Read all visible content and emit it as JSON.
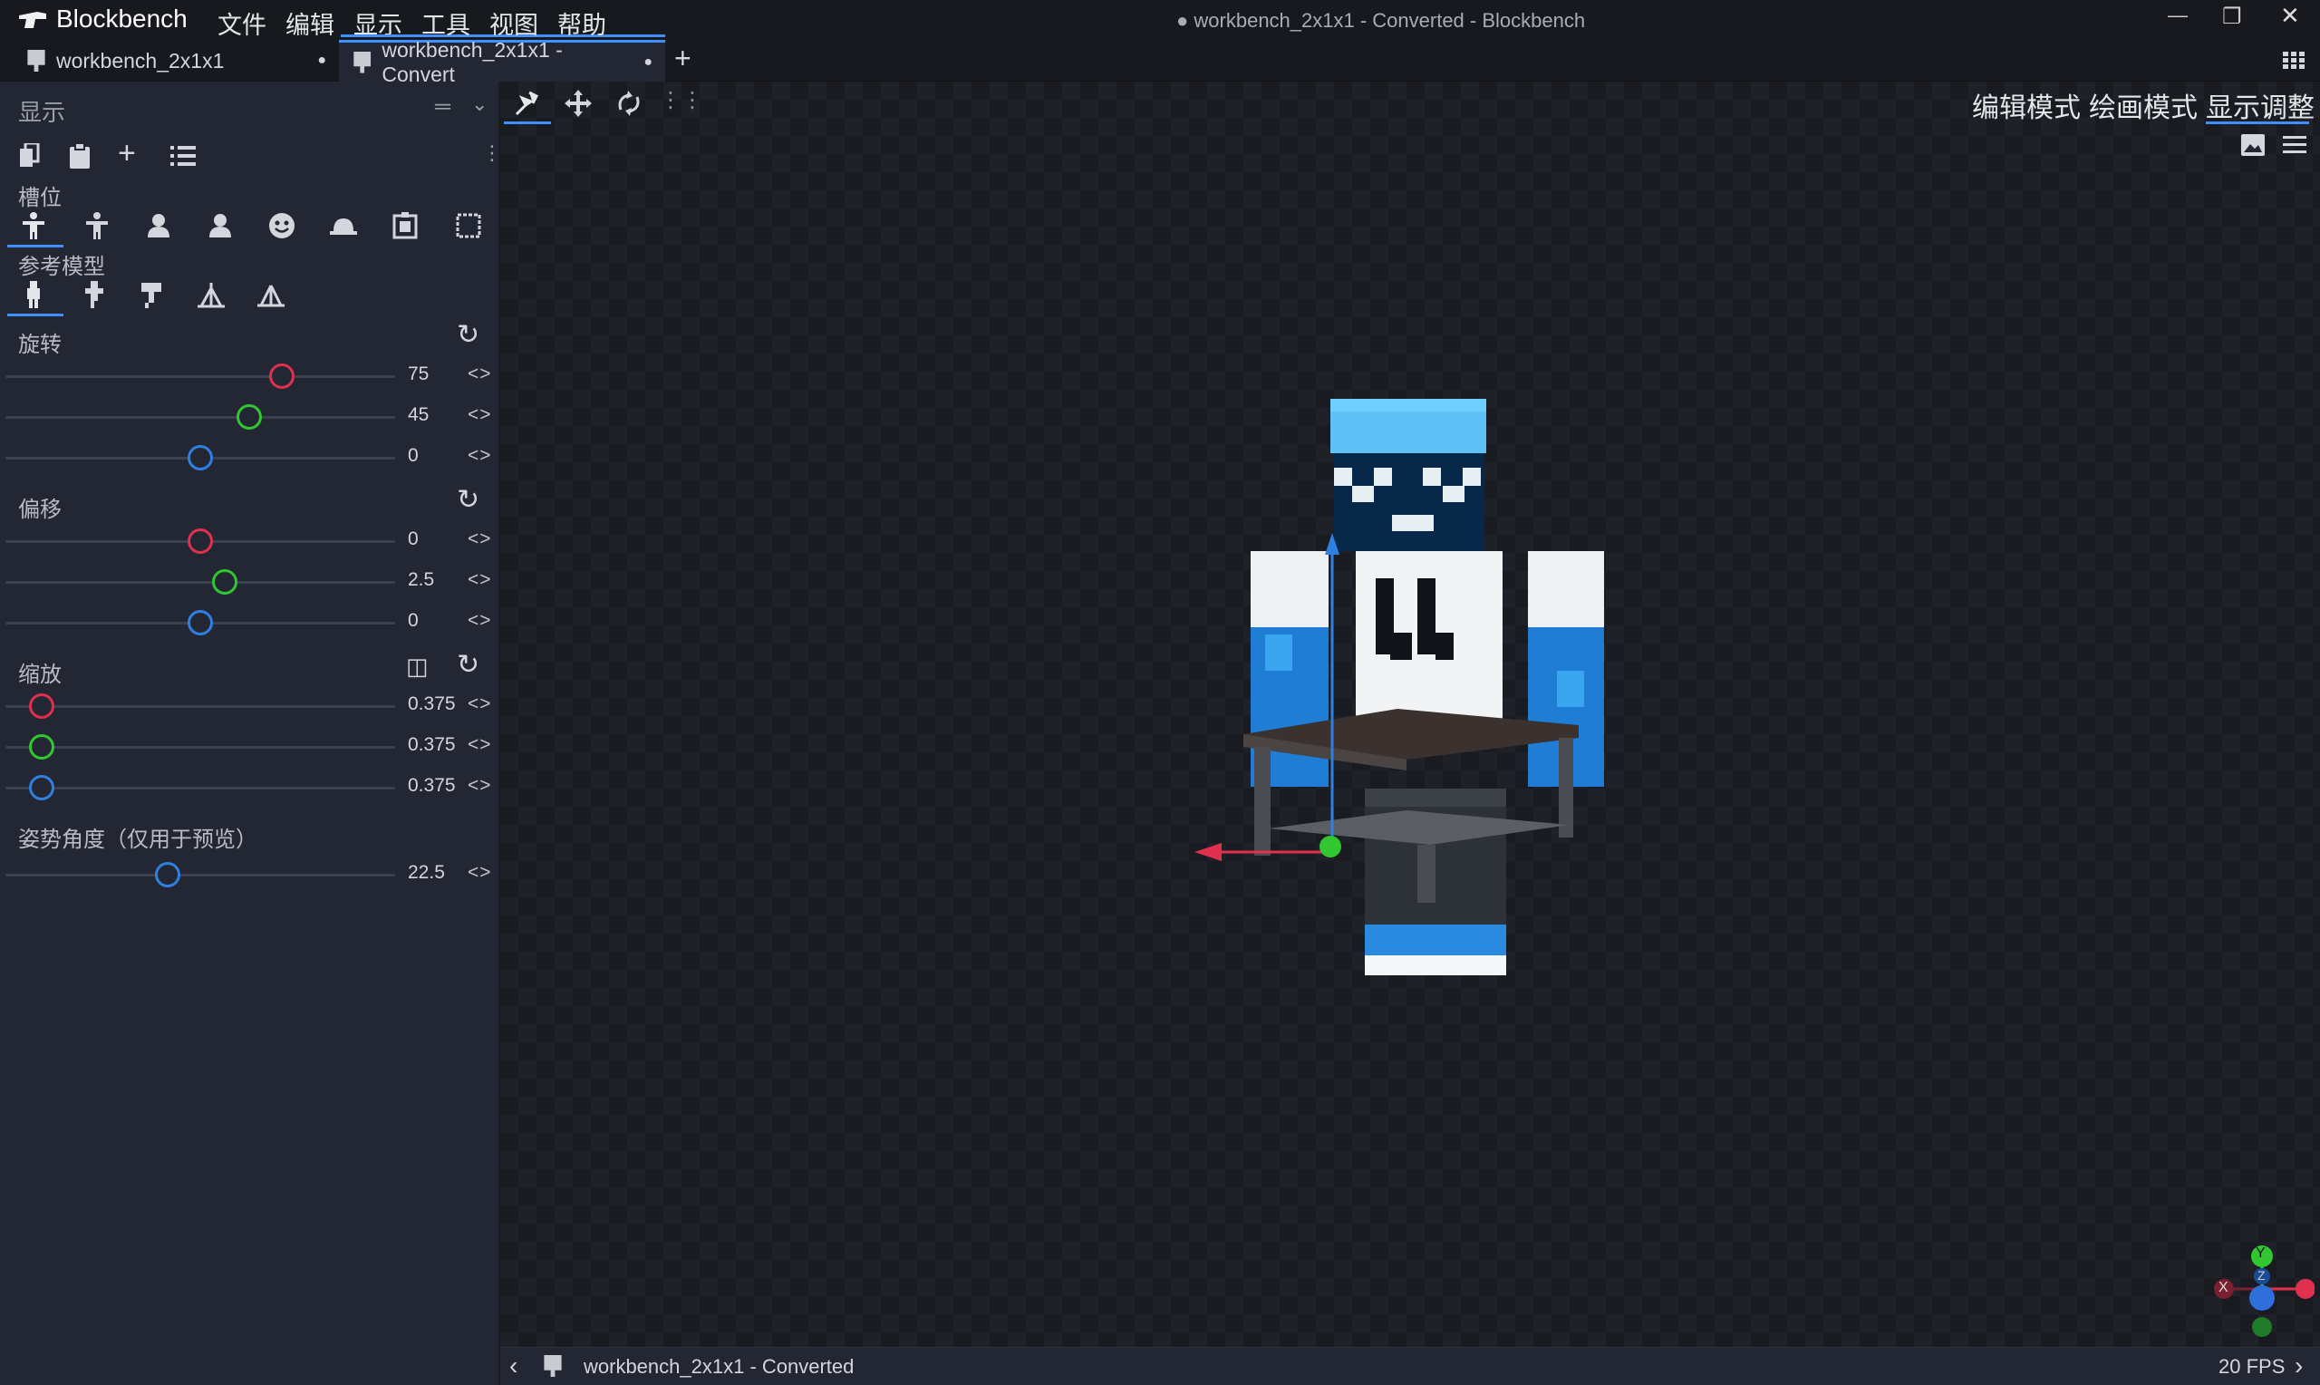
{
  "app": {
    "name": "Blockbench",
    "window_title": "● workbench_2x1x1 - Converted - Blockbench"
  },
  "menu": [
    "文件",
    "编辑",
    "显示",
    "工具",
    "视图",
    "帮助"
  ],
  "tabs": [
    {
      "label": "workbench_2x1x1",
      "dot": "●"
    },
    {
      "label": "workbench_2x1x1 - Convert",
      "dot": "●"
    }
  ],
  "window_controls": {
    "minimize": "—",
    "restore": "❐",
    "close": "✕"
  },
  "panel": {
    "title": "显示",
    "slot_label": "槽位",
    "ref_label": "参考模型",
    "rotation": {
      "label": "旋转",
      "values": [
        "75",
        "45",
        "0"
      ],
      "levels": [
        75,
        45,
        0
      ]
    },
    "offset": {
      "label": "偏移",
      "values": [
        "0",
        "2.5",
        "0"
      ],
      "levels": [
        0,
        2.5,
        0
      ]
    },
    "scale": {
      "label": "缩放",
      "values": [
        "0.375",
        "0.375",
        "0.375"
      ],
      "levels": [
        0.375,
        0.375,
        0.375
      ]
    },
    "pose": {
      "label": "姿势角度（仅用于预览）",
      "value": "22.5",
      "level": 22.5
    }
  },
  "modes": [
    "编辑模式",
    "绘画模式",
    "显示调整"
  ],
  "status": {
    "project": "workbench_2x1x1 - Converted",
    "fps": "20 FPS"
  },
  "axis_gizmo": {
    "y": "Y",
    "x": "X",
    "z": "Z"
  },
  "colors": {
    "x": "#e0304e",
    "y": "#32c630",
    "z": "#2f7fe0",
    "accent": "#3e90ff"
  }
}
